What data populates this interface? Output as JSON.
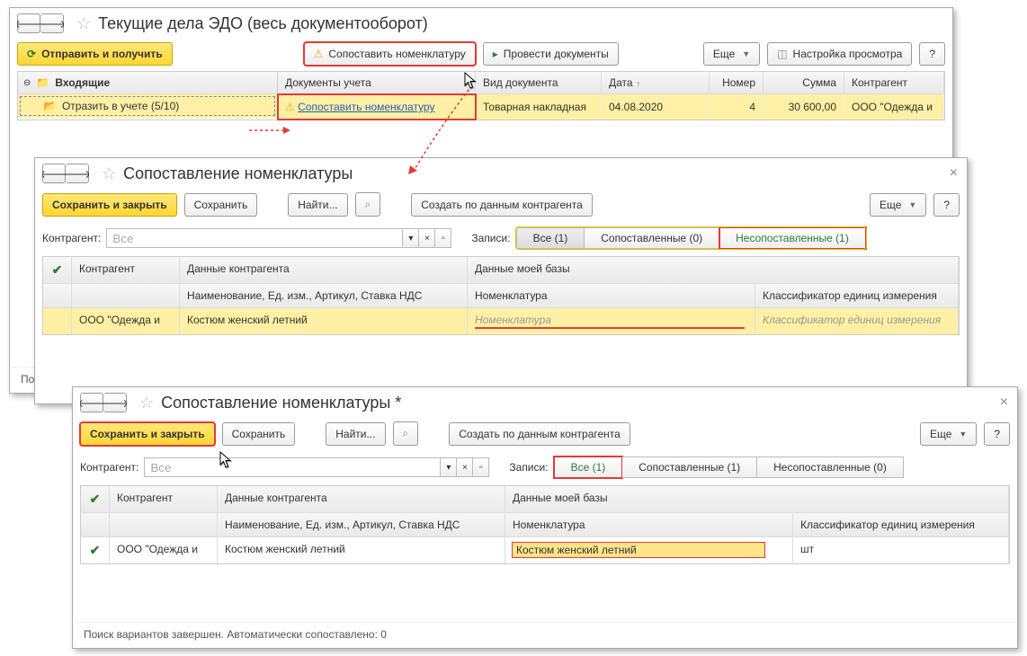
{
  "w1": {
    "title": "Текущие дела ЭДО (весь документооборот)",
    "send_btn": "Отправить и получить",
    "match_btn": "Сопоставить номенклатуру",
    "post_btn": "Провести документы",
    "more_btn": "Еще",
    "view_btn": "Настройка просмотра",
    "help_btn": "?",
    "side_header": "Входящие",
    "side_item": "Отразить в учете (5/10)",
    "cols": {
      "doc": "Документы учета",
      "type": "Вид документа",
      "date": "Дата",
      "num": "Номер",
      "sum": "Сумма",
      "ctr": "Контрагент"
    },
    "row": {
      "doc_link": "Сопоставить номенклатуру",
      "type": "Товарная накладная",
      "date": "04.08.2020",
      "num": "4",
      "sum": "30 600,00",
      "ctr": "ООО \"Одежда и"
    },
    "status": "Поис"
  },
  "w2": {
    "title": "Сопоставление номенклатуры",
    "save_close": "Сохранить и закрыть",
    "save": "Сохранить",
    "find": "Найти...",
    "create": "Создать по данным контрагента",
    "more_btn": "Еще",
    "help_btn": "?",
    "ctr_label": "Контрагент:",
    "ctr_value": "Все",
    "rec_label": "Записи:",
    "seg_all": "Все (1)",
    "seg_matched": "Сопоставленные (0)",
    "seg_unmatched": "Несопоставленные (1)",
    "h1": {
      "ctr": "Контрагент",
      "data": "Данные контрагента",
      "mybase": "Данные моей базы"
    },
    "h2": {
      "name": "Наименование, Ед. изм., Артикул, Ставка НДС",
      "nom": "Номенклатура",
      "cls": "Классификатор единиц измерения"
    },
    "row": {
      "ctr": "ООО \"Одежда и",
      "name": "Костюм женский летний",
      "nom_ph": "Номенклатура",
      "cls_ph": "Классификатор единиц измерения"
    }
  },
  "w3": {
    "title": "Сопоставление номенклатуры *",
    "save_close": "Сохранить и закрыть",
    "save": "Сохранить",
    "find": "Найти...",
    "create": "Создать по данным контрагента",
    "more_btn": "Еще",
    "help_btn": "?",
    "ctr_label": "Контрагент:",
    "ctr_value": "Все",
    "rec_label": "Записи:",
    "seg_all": "Все (1)",
    "seg_matched": "Сопоставленные (1)",
    "seg_unmatched": "Несопоставленные (0)",
    "h1": {
      "ctr": "Контрагент",
      "data": "Данные контрагента",
      "mybase": "Данные моей базы"
    },
    "h2": {
      "name": "Наименование, Ед. изм., Артикул, Ставка НДС",
      "nom": "Номенклатура",
      "cls": "Классификатор единиц измерения"
    },
    "row": {
      "ctr": "ООО \"Одежда и",
      "name": "Костюм женский летний",
      "nom": "Костюм женский летний",
      "cls": "шт"
    },
    "status": "Поиск вариантов завершен. Автоматически сопоставлено: 0"
  }
}
